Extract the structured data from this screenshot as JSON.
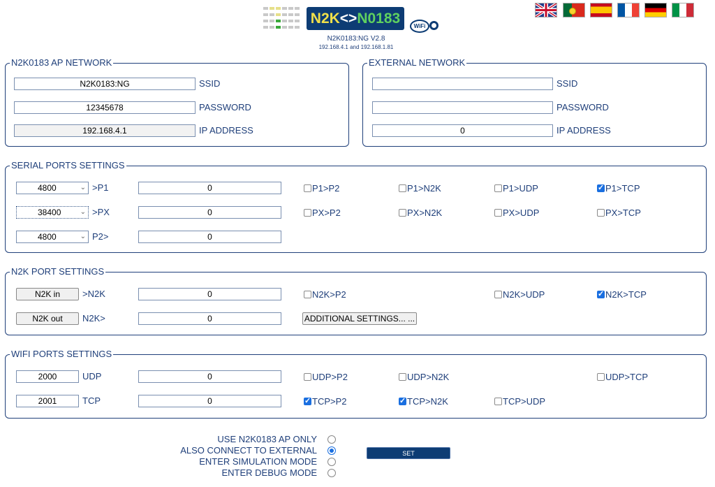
{
  "header": {
    "logo": {
      "left": "N2K",
      "mid": "<>",
      "right": "N0183"
    },
    "wifi_badge": "WiFi",
    "version": "N2K0183:NG V2.8",
    "ips": "192.168.4.1 and 192.168.1.81",
    "flags": [
      "uk-flag",
      "portugal-flag",
      "spain-flag",
      "france-flag",
      "germany-flag",
      "italy-flag"
    ]
  },
  "ap_network": {
    "legend": "N2K0183 AP NETWORK",
    "ssid": {
      "value": "N2K0183:NG",
      "label": "SSID"
    },
    "password": {
      "value": "12345678",
      "label": "PASSWORD"
    },
    "ip": {
      "value": "192.168.4.1",
      "label": "IP ADDRESS"
    }
  },
  "external_network": {
    "legend": "EXTERNAL NETWORK",
    "ssid": {
      "value": "",
      "label": "SSID"
    },
    "password": {
      "value": "",
      "label": "PASSWORD"
    },
    "ip": {
      "value": "0",
      "label": "IP ADDRESS"
    }
  },
  "serial": {
    "legend": "SERIAL PORTS SETTINGS",
    "p1": {
      "baud": "4800",
      "label": ">P1",
      "count": "0",
      "checks": [
        {
          "label": "P1>P2",
          "checked": false
        },
        {
          "label": "P1>N2K",
          "checked": false
        },
        {
          "label": "P1>UDP",
          "checked": false
        },
        {
          "label": "P1>TCP",
          "checked": true
        }
      ]
    },
    "px": {
      "baud": "38400",
      "label": ">PX",
      "count": "0",
      "checks": [
        {
          "label": "PX>P2",
          "checked": false
        },
        {
          "label": "PX>N2K",
          "checked": false
        },
        {
          "label": "PX>UDP",
          "checked": false
        },
        {
          "label": "PX>TCP",
          "checked": false
        }
      ]
    },
    "p2": {
      "baud": "4800",
      "label": "P2>",
      "count": "0"
    }
  },
  "n2k": {
    "legend": "N2K PORT SETTINGS",
    "in": {
      "button": "N2K in",
      "label": ">N2K",
      "count": "0",
      "checks": [
        {
          "label": "N2K>P2",
          "checked": false
        },
        {
          "label": "N2K>UDP",
          "checked": false
        },
        {
          "label": "N2K>TCP",
          "checked": true
        }
      ]
    },
    "out": {
      "button": "N2K out",
      "label": "N2K>",
      "count": "0",
      "additional": "ADDITIONAL SETTINGS... ..."
    }
  },
  "wifi": {
    "legend": "WIFI PORTS SETTINGS",
    "udp": {
      "port": "2000",
      "label": "UDP",
      "count": "0",
      "checks": [
        {
          "label": "UDP>P2",
          "checked": false
        },
        {
          "label": "UDP>N2K",
          "checked": false
        },
        {
          "label": "UDP>TCP",
          "checked": false
        }
      ]
    },
    "tcp": {
      "port": "2001",
      "label": "TCP",
      "count": "0",
      "checks": [
        {
          "label": "TCP>P2",
          "checked": true
        },
        {
          "label": "TCP>N2K",
          "checked": true
        },
        {
          "label": "TCP>UDP",
          "checked": false
        }
      ]
    }
  },
  "modes": [
    {
      "label": "USE N2K0183 AP ONLY",
      "selected": false
    },
    {
      "label": "ALSO CONNECT TO EXTERNAL",
      "selected": true
    },
    {
      "label": "ENTER SIMULATION MODE",
      "selected": false
    },
    {
      "label": "ENTER DEBUG MODE",
      "selected": false
    }
  ],
  "set_button": "SET",
  "colors": {
    "navy": "#0d3c74",
    "text": "#1f3f7a",
    "check": "#1a6fe0"
  }
}
